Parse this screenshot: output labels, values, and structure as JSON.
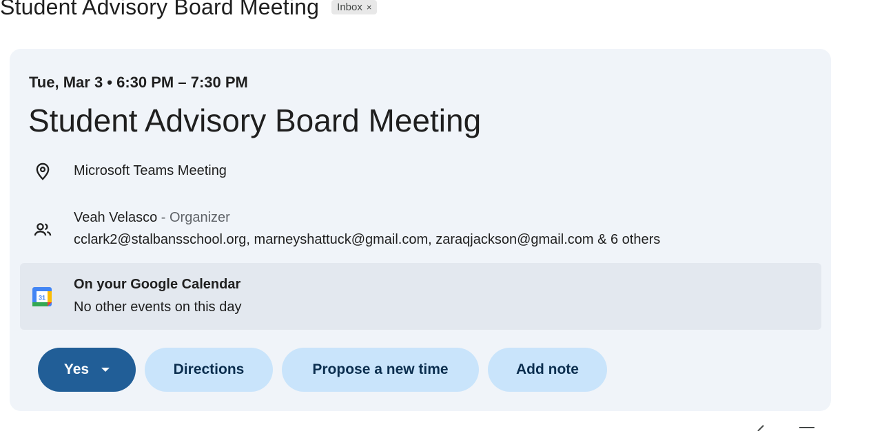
{
  "email": {
    "subject": "Student Advisory Board Meeting",
    "label_chip": "Inbox",
    "label_chip_close": "×"
  },
  "event": {
    "datetime": "Tue, Mar 3 • 6:30 PM – 7:30 PM",
    "title": "Student Advisory Board Meeting",
    "location": "Microsoft Teams Meeting",
    "organizer_name": "Veah Velasco",
    "organizer_role": " - Organizer",
    "attendees": "cclark2@stalbansschool.org, marneyshattuck@gmail.com, zaraqjackson@gmail.com & 6 others"
  },
  "calendar": {
    "title": "On your Google Calendar",
    "subtitle": "No other events on this day",
    "icon_day": "31"
  },
  "actions": {
    "rsvp_label": "Yes",
    "directions_label": "Directions",
    "propose_label": "Propose a new time",
    "note_label": "Add note"
  },
  "colors": {
    "card_bg": "#f0f4f9",
    "primary_button": "#215e97",
    "secondary_button": "#c9e4fb"
  },
  "icons": {
    "location": "location-pin-icon",
    "people": "people-icon",
    "calendar": "google-calendar-icon"
  }
}
